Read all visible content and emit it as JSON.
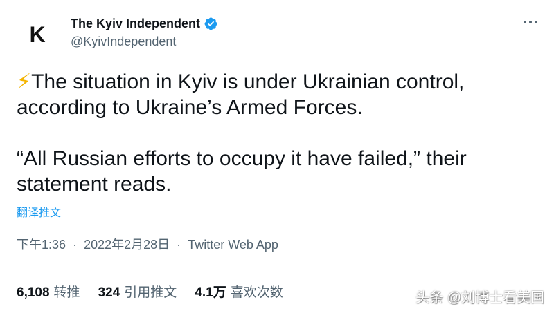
{
  "author": {
    "avatar_letter": "K",
    "display_name": "The Kyiv Independent",
    "handle": "@KyivIndependent",
    "verified": true,
    "verified_color": "#1d9bf0"
  },
  "tweet": {
    "emoji": "⚡",
    "line1": "The situation in Kyiv is under Ukrainian control, according to Ukraine’s Armed Forces.",
    "line2": "“All Russian efforts to occupy it have failed,” their statement reads.",
    "translate_label": "翻译推文"
  },
  "meta": {
    "time": "下午1:36",
    "separator": "·",
    "date": "2022年2月28日",
    "client": "Twitter Web App"
  },
  "stats": {
    "retweets_count": "6,108",
    "retweets_label": "转推",
    "quotes_count": "324",
    "quotes_label": "引用推文",
    "likes_count": "4.1万",
    "likes_label": "喜欢次数"
  },
  "watermark": {
    "text": "头条 @刘博士看美国"
  },
  "colors": {
    "link_blue": "#1d9bf0",
    "secondary_text": "#536471",
    "primary_text": "#0f1419"
  }
}
